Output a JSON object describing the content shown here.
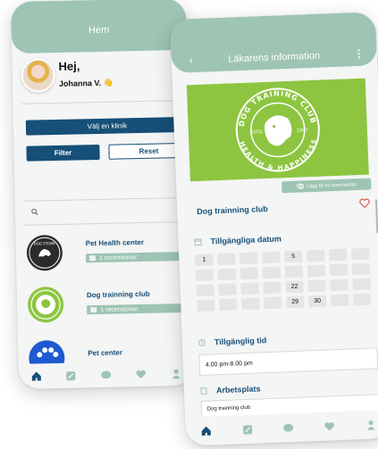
{
  "back_phone": {
    "header_title": "Hem",
    "greeting": "Hej,",
    "user_name": "Johanna V. 👋",
    "clinic_select": "Välj en klinik",
    "filter_label": "Filter",
    "reset_label": "Reset",
    "clinics": [
      {
        "name": "Pet Health center",
        "reviews": "1 recensioner",
        "logo": "dog-store-logo"
      },
      {
        "name": "Dog trainning club",
        "reviews": "1 recensioner",
        "logo": "dog-training-club-logo"
      },
      {
        "name": "Pet center",
        "logo": "paw-logo"
      }
    ],
    "tabs": [
      "home-icon",
      "edit-icon",
      "chat-icon",
      "heart-icon",
      "user-icon"
    ]
  },
  "front_phone": {
    "header_title": "Läkarens information",
    "hero_text_top": "DOG TRAINING CLUB",
    "hero_text_bottom": "HEALTH & HAPPINESS",
    "hero_est": "ESTD",
    "hero_year": "1987",
    "comment_button": "Lägg till en kommentar",
    "club_name": "Dog trainning club",
    "available_dates_title": "Tillgängliga datum",
    "calendar": [
      "1",
      "",
      "",
      "",
      "5",
      "",
      "",
      "",
      "",
      "",
      "",
      "",
      "",
      "",
      "",
      "",
      "",
      "",
      "",
      "",
      "22",
      "",
      "",
      "",
      "",
      "",
      "",
      "",
      "29",
      "30",
      "",
      ""
    ],
    "available_time_title": "Tillgänglig tid",
    "available_time_value": "4.00 pm-8.00 pm",
    "workplace_title": "Arbetsplats",
    "workplace_value": "Dog trainning club",
    "tabs": [
      "home-icon",
      "edit-icon",
      "chat-icon",
      "heart-icon",
      "user-icon"
    ]
  },
  "colors": {
    "accent": "#9ec4b3",
    "primary": "#164f77",
    "hero": "#8dc540",
    "heart": "#e05a4f"
  }
}
